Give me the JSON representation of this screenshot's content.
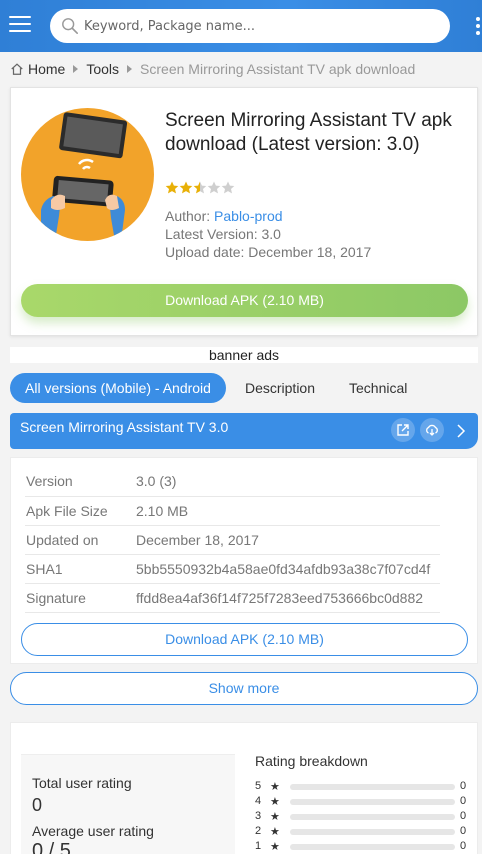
{
  "header": {
    "search_placeholder": "Keyword, Package name..."
  },
  "breadcrumb": {
    "home": "Home",
    "category": "Tools",
    "current": "Screen Mirroring Assistant TV apk download"
  },
  "app": {
    "title": "Screen Mirroring Assistant TV apk download (Latest version: 3.0)",
    "rating_stars": 2.5,
    "author_label": "Author: ",
    "author": "Pablo-prod",
    "latest_version": "Latest Version: 3.0",
    "upload_date": "Upload date: December 18, 2017",
    "download_label": "Download APK (2.10 MB)"
  },
  "banner": "banner ads",
  "tabs": [
    "All versions (Mobile) - Android",
    "Description",
    "Technical"
  ],
  "version": {
    "title": "Screen Mirroring Assistant TV 3.0",
    "rows": [
      {
        "k": "Version",
        "v": "3.0 (3)"
      },
      {
        "k": "Apk File Size",
        "v": "2.10 MB"
      },
      {
        "k": "Updated on",
        "v": "December 18, 2017"
      },
      {
        "k": "SHA1",
        "v": "5bb5550932b4a58ae0fd34afdb93a38c7f07cd4f"
      },
      {
        "k": "Signature",
        "v": "ffdd8ea4af36f14f725f7283eed753666bc0d882"
      }
    ],
    "download_label": "Download APK (2.10 MB)",
    "show_more": "Show more"
  },
  "ratings": {
    "total_label": "Total user rating",
    "total_value": "0",
    "avg_label": "Average user rating",
    "avg_value": "0 / 5",
    "breakdown_title": "Rating breakdown",
    "breakdown": [
      {
        "stars": "5",
        "count": "0"
      },
      {
        "stars": "4",
        "count": "0"
      },
      {
        "stars": "3",
        "count": "0"
      },
      {
        "stars": "2",
        "count": "0"
      },
      {
        "stars": "1",
        "count": "0"
      }
    ]
  },
  "colors": {
    "accent": "#3a8ee6",
    "download_green": "#8cc865",
    "icon_bg": "#f2a32a"
  }
}
